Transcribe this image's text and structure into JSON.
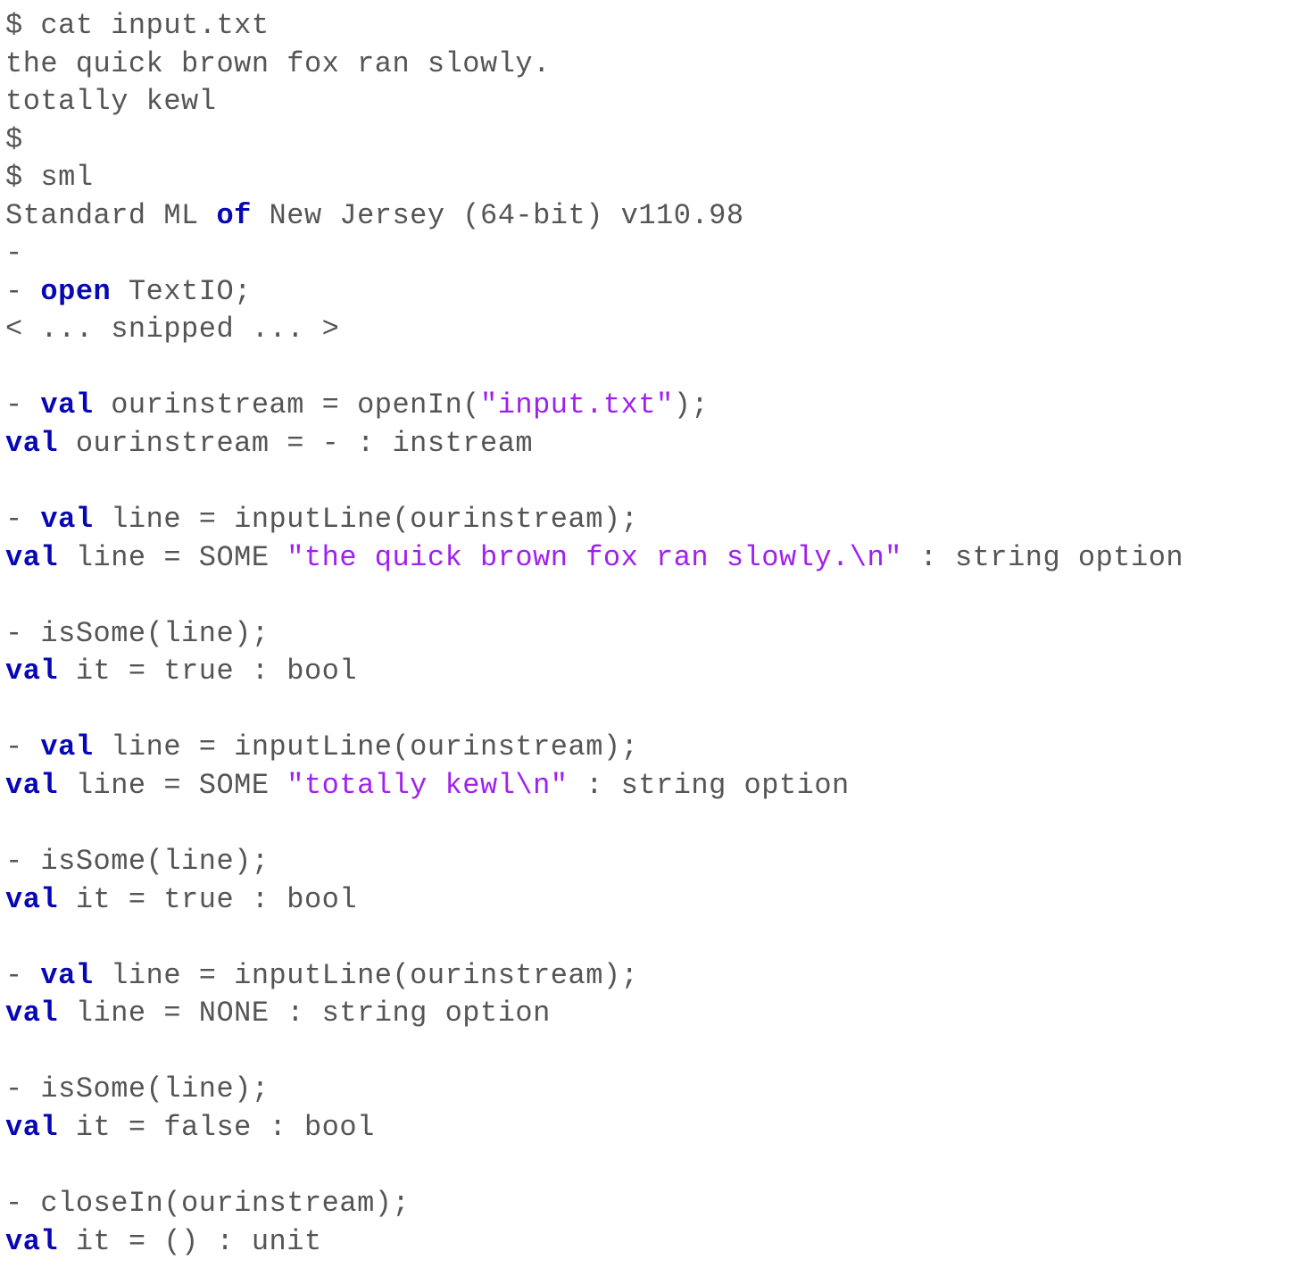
{
  "tokens": [
    {
      "t": "$ cat input.txt"
    },
    {
      "br": true
    },
    {
      "t": "the quick brown fox ran slowly."
    },
    {
      "br": true
    },
    {
      "t": "totally kewl"
    },
    {
      "br": true
    },
    {
      "t": "$"
    },
    {
      "br": true
    },
    {
      "t": "$ sml"
    },
    {
      "br": true
    },
    {
      "t": "Standard ML "
    },
    {
      "t": "of",
      "c": "kw"
    },
    {
      "t": " New Jersey (64-bit) v110.98"
    },
    {
      "br": true
    },
    {
      "t": "-"
    },
    {
      "br": true
    },
    {
      "t": "- "
    },
    {
      "t": "open",
      "c": "kw"
    },
    {
      "t": " TextIO;"
    },
    {
      "br": true
    },
    {
      "t": "< ... snipped ... >"
    },
    {
      "br": true
    },
    {
      "br": true
    },
    {
      "t": "- "
    },
    {
      "t": "val",
      "c": "kw"
    },
    {
      "t": " ourinstream = openIn("
    },
    {
      "t": "\"input.txt\"",
      "c": "str"
    },
    {
      "t": ");"
    },
    {
      "br": true
    },
    {
      "t": "val",
      "c": "kw"
    },
    {
      "t": " ourinstream = - : instream"
    },
    {
      "br": true
    },
    {
      "br": true
    },
    {
      "t": "- "
    },
    {
      "t": "val",
      "c": "kw"
    },
    {
      "t": " line = inputLine(ourinstream);"
    },
    {
      "br": true
    },
    {
      "t": "val",
      "c": "kw"
    },
    {
      "t": " line = SOME "
    },
    {
      "t": "\"the quick brown fox ran slowly.\\n\"",
      "c": "str"
    },
    {
      "t": " : string option"
    },
    {
      "br": true
    },
    {
      "br": true
    },
    {
      "t": "- isSome(line);"
    },
    {
      "br": true
    },
    {
      "t": "val",
      "c": "kw"
    },
    {
      "t": " it = true : bool"
    },
    {
      "br": true
    },
    {
      "br": true
    },
    {
      "t": "- "
    },
    {
      "t": "val",
      "c": "kw"
    },
    {
      "t": " line = inputLine(ourinstream);"
    },
    {
      "br": true
    },
    {
      "t": "val",
      "c": "kw"
    },
    {
      "t": " line = SOME "
    },
    {
      "t": "\"totally kewl\\n\"",
      "c": "str"
    },
    {
      "t": " : string option"
    },
    {
      "br": true
    },
    {
      "br": true
    },
    {
      "t": "- isSome(line);"
    },
    {
      "br": true
    },
    {
      "t": "val",
      "c": "kw"
    },
    {
      "t": " it = true : bool"
    },
    {
      "br": true
    },
    {
      "br": true
    },
    {
      "t": "- "
    },
    {
      "t": "val",
      "c": "kw"
    },
    {
      "t": " line = inputLine(ourinstream);"
    },
    {
      "br": true
    },
    {
      "t": "val",
      "c": "kw"
    },
    {
      "t": " line = NONE : string option"
    },
    {
      "br": true
    },
    {
      "br": true
    },
    {
      "t": "- isSome(line);"
    },
    {
      "br": true
    },
    {
      "t": "val",
      "c": "kw"
    },
    {
      "t": " it = false : bool"
    },
    {
      "br": true
    },
    {
      "br": true
    },
    {
      "t": "- closeIn(ourinstream);"
    },
    {
      "br": true
    },
    {
      "t": "val",
      "c": "kw"
    },
    {
      "t": " it = () : unit"
    }
  ]
}
